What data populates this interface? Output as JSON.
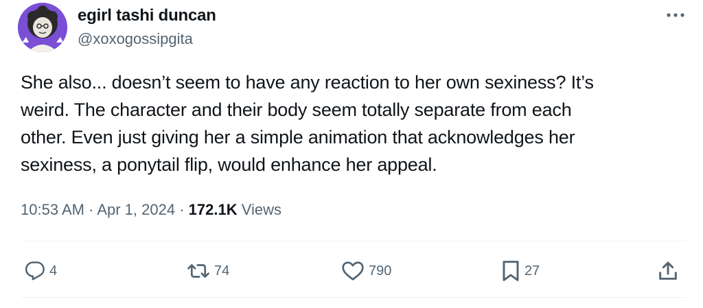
{
  "author": {
    "display_name": "egirl tashi duncan",
    "handle": "@xoxogossipgita"
  },
  "tweet": {
    "text": "She also... doesn’t seem to have any reaction to her own sexiness? It’s\nweird. The character and their body seem totally separate from each\nother. Even just giving her a simple animation that acknowledges her\nsexiness, a ponytail flip, would enhance her appeal.",
    "time": "10:53 AM",
    "separator": "·",
    "date": "Apr 1, 2024",
    "views_count": "172.1K",
    "views_label": "Views"
  },
  "actions": {
    "replies": "4",
    "reposts": "74",
    "likes": "790",
    "bookmarks": "27"
  },
  "icons": {
    "more": "more-icon",
    "reply": "reply-icon",
    "repost": "repost-icon",
    "like": "heart-icon",
    "bookmark": "bookmark-icon",
    "share": "share-icon"
  },
  "colors": {
    "text": "#0f1419",
    "secondary": "#536471",
    "divider": "#eff3f4",
    "avatar_bg": "#7a4fd6"
  }
}
